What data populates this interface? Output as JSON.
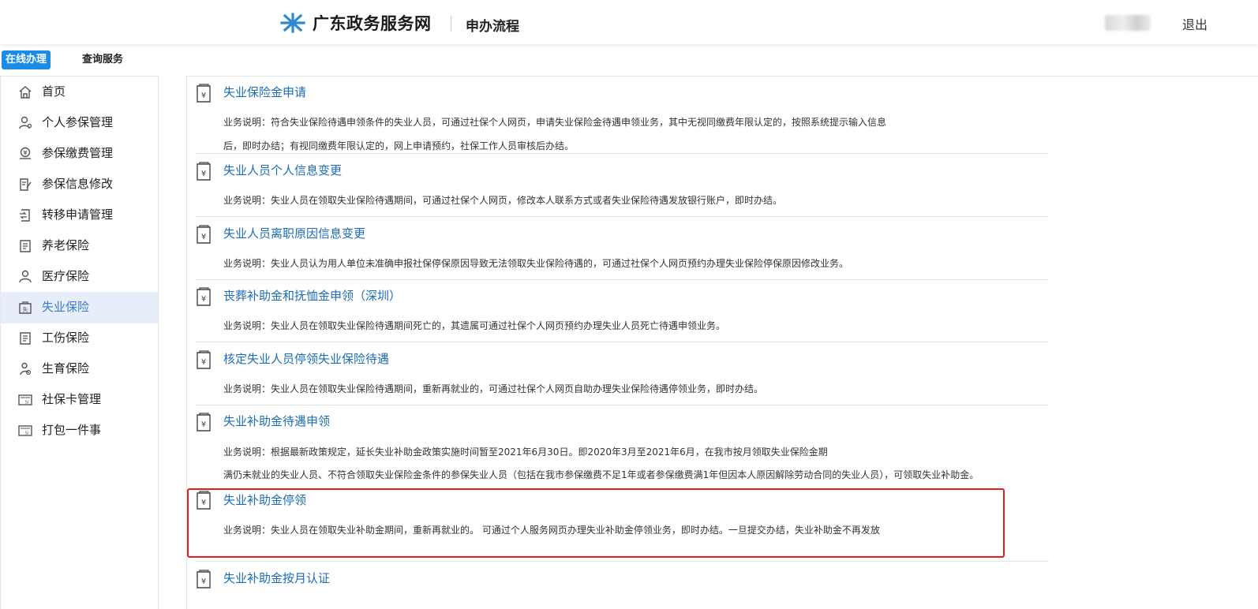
{
  "header": {
    "site_title": "广东政务服务网",
    "page_title": "申办流程",
    "logout_label": "退出"
  },
  "tabs": {
    "online": "在线办理",
    "query": "查询服务"
  },
  "sidebar": {
    "items": [
      {
        "label": "首页",
        "icon": "home-icon"
      },
      {
        "label": "个人参保管理",
        "icon": "person-icon"
      },
      {
        "label": "参保缴费管理",
        "icon": "payment-icon"
      },
      {
        "label": "参保信息修改",
        "icon": "edit-doc-icon"
      },
      {
        "label": "转移申请管理",
        "icon": "transfer-icon"
      },
      {
        "label": "养老保险",
        "icon": "document-icon"
      },
      {
        "label": "医疗保险",
        "icon": "medical-person-icon"
      },
      {
        "label": "失业保险",
        "icon": "unemployment-icon",
        "active": true
      },
      {
        "label": "工伤保险",
        "icon": "document-icon"
      },
      {
        "label": "生育保险",
        "icon": "maternity-icon"
      },
      {
        "label": "社保卡管理",
        "icon": "card-icon"
      },
      {
        "label": "打包一件事",
        "icon": "card-icon"
      }
    ]
  },
  "services": [
    {
      "title": "失业保险金申请",
      "desc": [
        "业务说明：符合失业保险待遇申领条件的失业人员，可通过社保个人网页，申请失业保险金待遇申领业务，其中无视同缴费年限认定的，按照系统提示输入信息",
        "后，即时办结；有视同缴费年限认定的，网上申请预约，社保工作人员审核后办结。"
      ]
    },
    {
      "title": "失业人员个人信息变更",
      "desc": [
        "业务说明：失业人员在领取失业保险待遇期间，可通过社保个人网页，修改本人联系方式或者失业保险待遇发放银行账户，即时办结。"
      ]
    },
    {
      "title": "失业人员离职原因信息变更",
      "desc": [
        "业务说明：失业人员认为用人单位未准确申报社保停保原因导致无法领取失业保险待遇的，可通过社保个人网页预约办理失业保险停保原因修改业务。"
      ]
    },
    {
      "title": "丧葬补助金和抚恤金申领（深圳）",
      "desc": [
        "业务说明：失业人员在领取失业保险待遇期间死亡的，其遗属可通过社保个人网页预约办理失业人员死亡待遇申领业务。"
      ]
    },
    {
      "title": "核定失业人员停领失业保险待遇",
      "desc": [
        "业务说明：失业人员在领取失业保险待遇期间，重新再就业的，可通过社保个人网页自助办理失业保险待遇停领业务，即时办结。"
      ]
    },
    {
      "title": "失业补助金待遇申领",
      "desc": [
        "业务说明：根据最新政策规定，延长失业补助金政策实施时间暂至2021年6月30日。即2020年3月至2021年6月，在我市按月领取失业保险金期",
        "满仍未就业的失业人员、不符合领取失业保险金条件的参保失业人员（包括在我市参保缴费不足1年或者参保缴费满1年但因本人原因解除劳动合同的失业人员），可领取失业补助金。"
      ]
    },
    {
      "title": "失业补助金停领",
      "desc": [
        "业务说明：失业人员在领取失业补助金期间，重新再就业的。 可通过个人服务网页办理失业补助金停领业务，即时办结。一旦提交办结，失业补助金不再发放"
      ],
      "highlighted": true
    },
    {
      "title": "失业补助金按月认证",
      "desc": []
    }
  ],
  "colors": {
    "accent": "#1a8ce8",
    "link": "#1b6db5",
    "highlight": "#e21f1f",
    "active_bg": "#e8eef9"
  }
}
